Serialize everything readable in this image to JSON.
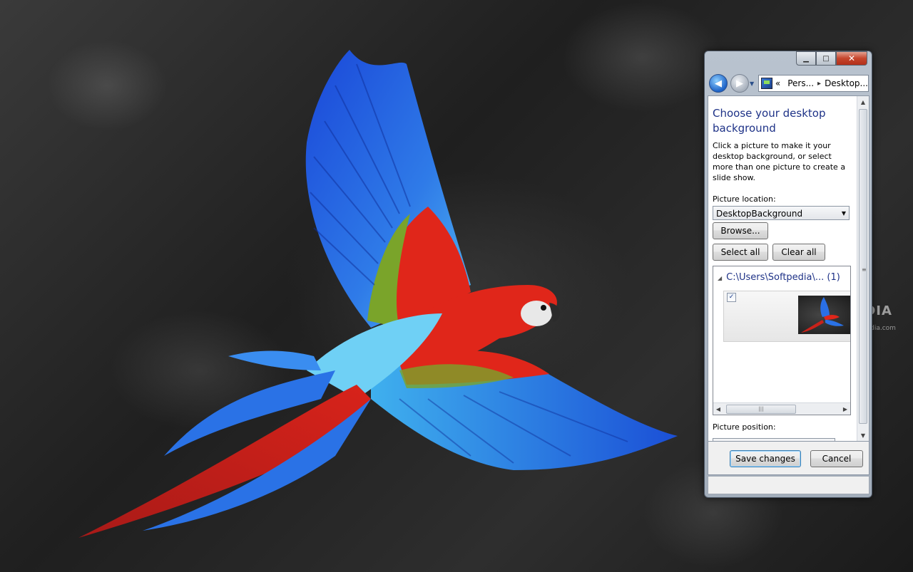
{
  "window": {
    "caption": {
      "minimize": "▁",
      "maximize": "□",
      "close": "✕"
    },
    "nav": {
      "back_icon": "back-arrow-icon",
      "forward_icon": "forward-arrow-icon"
    },
    "breadcrumb": {
      "chevrons": "«",
      "item1": "Pers...",
      "sep": "▸",
      "item2": "Desktop..."
    }
  },
  "content": {
    "title": "Choose your desktop background",
    "description": "Click a picture to make it your desktop background, or select more than one picture to create a slide show.",
    "picture_location_label": "Picture location:",
    "picture_location_value": "DesktopBackground",
    "browse_label": "Browse...",
    "select_all_label": "Select all",
    "clear_all_label": "Clear all",
    "group_header": "C:\\Users\\Softpedia\\... (1)",
    "checkbox_mark": "✓",
    "picture_position_label": "Picture position:"
  },
  "footer": {
    "save_label": "Save changes",
    "cancel_label": "Cancel"
  },
  "watermark": {
    "main": "SOFTPEDIA",
    "sub": "www.softpedia.com"
  },
  "colors": {
    "title_blue": "#1e3287",
    "macaw_red": "#e0261a",
    "macaw_blue": "#1f5fe0",
    "macaw_cyan": "#3fb4ef",
    "macaw_green": "#7aa42a"
  }
}
